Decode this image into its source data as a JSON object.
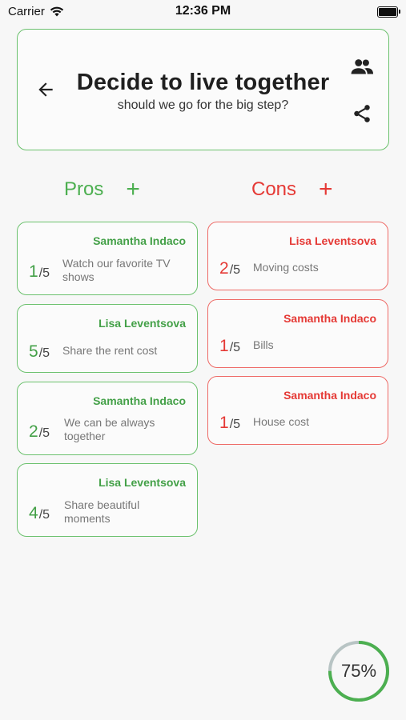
{
  "status_bar": {
    "carrier": "Carrier",
    "time": "12:36 PM"
  },
  "header": {
    "title": "Decide to live together",
    "subtitle": "should we go for the big step?"
  },
  "pros": {
    "label": "Pros",
    "color": "#4caf50",
    "items": [
      {
        "author": "Samantha Indaco",
        "score": "1",
        "max": "/5",
        "text": "Watch our favorite TV shows"
      },
      {
        "author": "Lisa Leventsova",
        "score": "5",
        "max": "/5",
        "text": "Share the rent cost"
      },
      {
        "author": "Samantha Indaco",
        "score": "2",
        "max": "/5",
        "text": "We can be always together"
      },
      {
        "author": "Lisa Leventsova",
        "score": "4",
        "max": "/5",
        "text": "Share beautiful moments"
      }
    ]
  },
  "cons": {
    "label": "Cons",
    "color": "#e53935",
    "items": [
      {
        "author": "Lisa Leventsova",
        "score": "2",
        "max": "/5",
        "text": "Moving costs"
      },
      {
        "author": "Samantha Indaco",
        "score": "1",
        "max": "/5",
        "text": "Bills"
      },
      {
        "author": "Samantha Indaco",
        "score": "1",
        "max": "/5",
        "text": "House cost"
      }
    ]
  },
  "progress": {
    "label": "75%",
    "value": 0.75
  },
  "icons": [
    "wifi-icon",
    "battery-icon",
    "back-arrow-icon",
    "people-icon",
    "share-icon",
    "plus-icon"
  ]
}
